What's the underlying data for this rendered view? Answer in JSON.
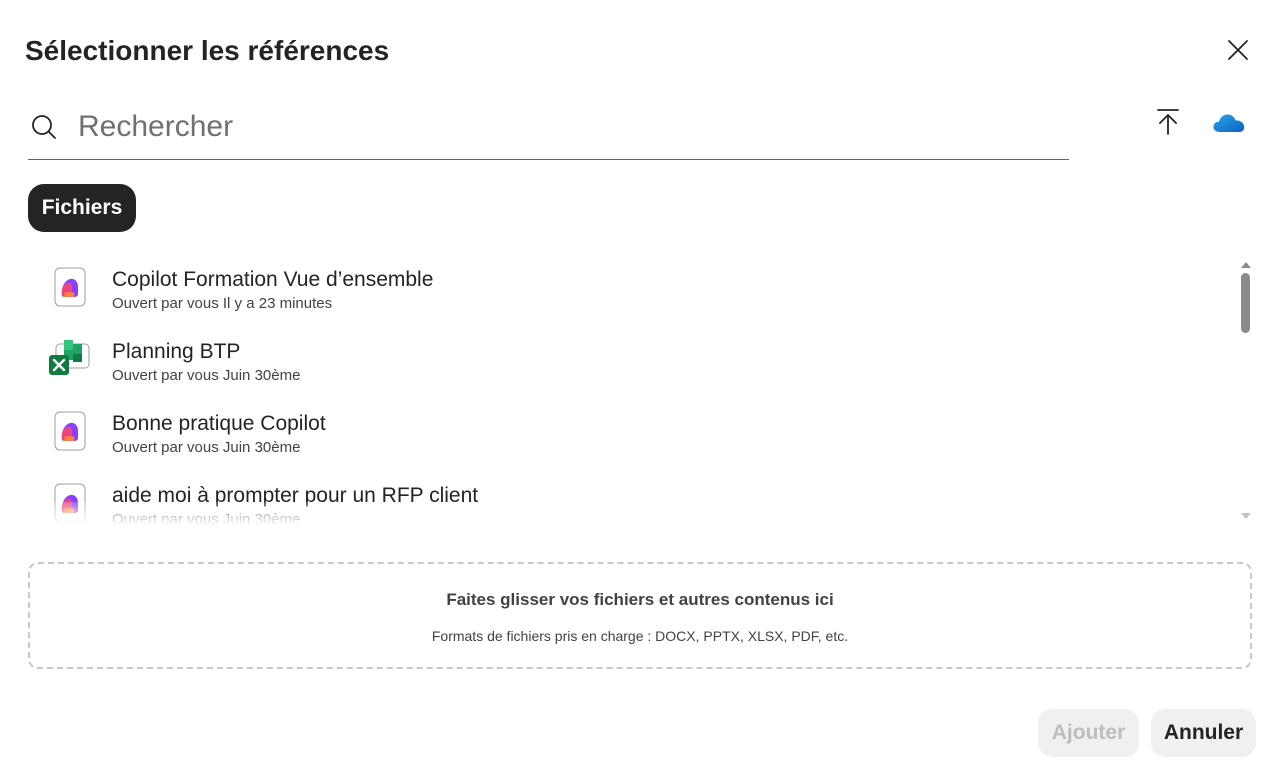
{
  "dialog": {
    "title": "Sélectionner les références"
  },
  "search": {
    "placeholder": "Rechercher",
    "value": ""
  },
  "filters": {
    "active_chip": "Fichiers"
  },
  "files": [
    {
      "name": "Copilot Formation Vue d’ensemble",
      "meta": "Ouvert par vous Il y a 23 minutes",
      "icon": "copilot-page-icon"
    },
    {
      "name": "Planning BTP",
      "meta": "Ouvert par vous Juin 30ème",
      "icon": "excel-icon"
    },
    {
      "name": "Bonne pratique Copilot",
      "meta": "Ouvert par vous Juin 30ème",
      "icon": "copilot-page-icon"
    },
    {
      "name": "aide moi à prompter pour un RFP client",
      "meta": "Ouvert par vous Juin 30ème",
      "icon": "copilot-page-icon"
    }
  ],
  "dropzone": {
    "title": "Faites glisser vos fichiers et autres contenus ici",
    "subtitle": "Formats de fichiers pris en charge : DOCX, PPTX, XLSX, PDF, etc."
  },
  "footer": {
    "add_label": "Ajouter",
    "cancel_label": "Annuler"
  },
  "icons": {
    "close": "close-icon",
    "search": "search-icon",
    "upload": "upload-icon",
    "onedrive": "onedrive-cloud-icon"
  },
  "colors": {
    "chip_bg": "#242424",
    "excel_green": "#107c41",
    "copilot_gradient": [
      "#f0427f",
      "#8a3ffc",
      "#ff8a3d"
    ],
    "onedrive_blue": "#0f78d4"
  }
}
